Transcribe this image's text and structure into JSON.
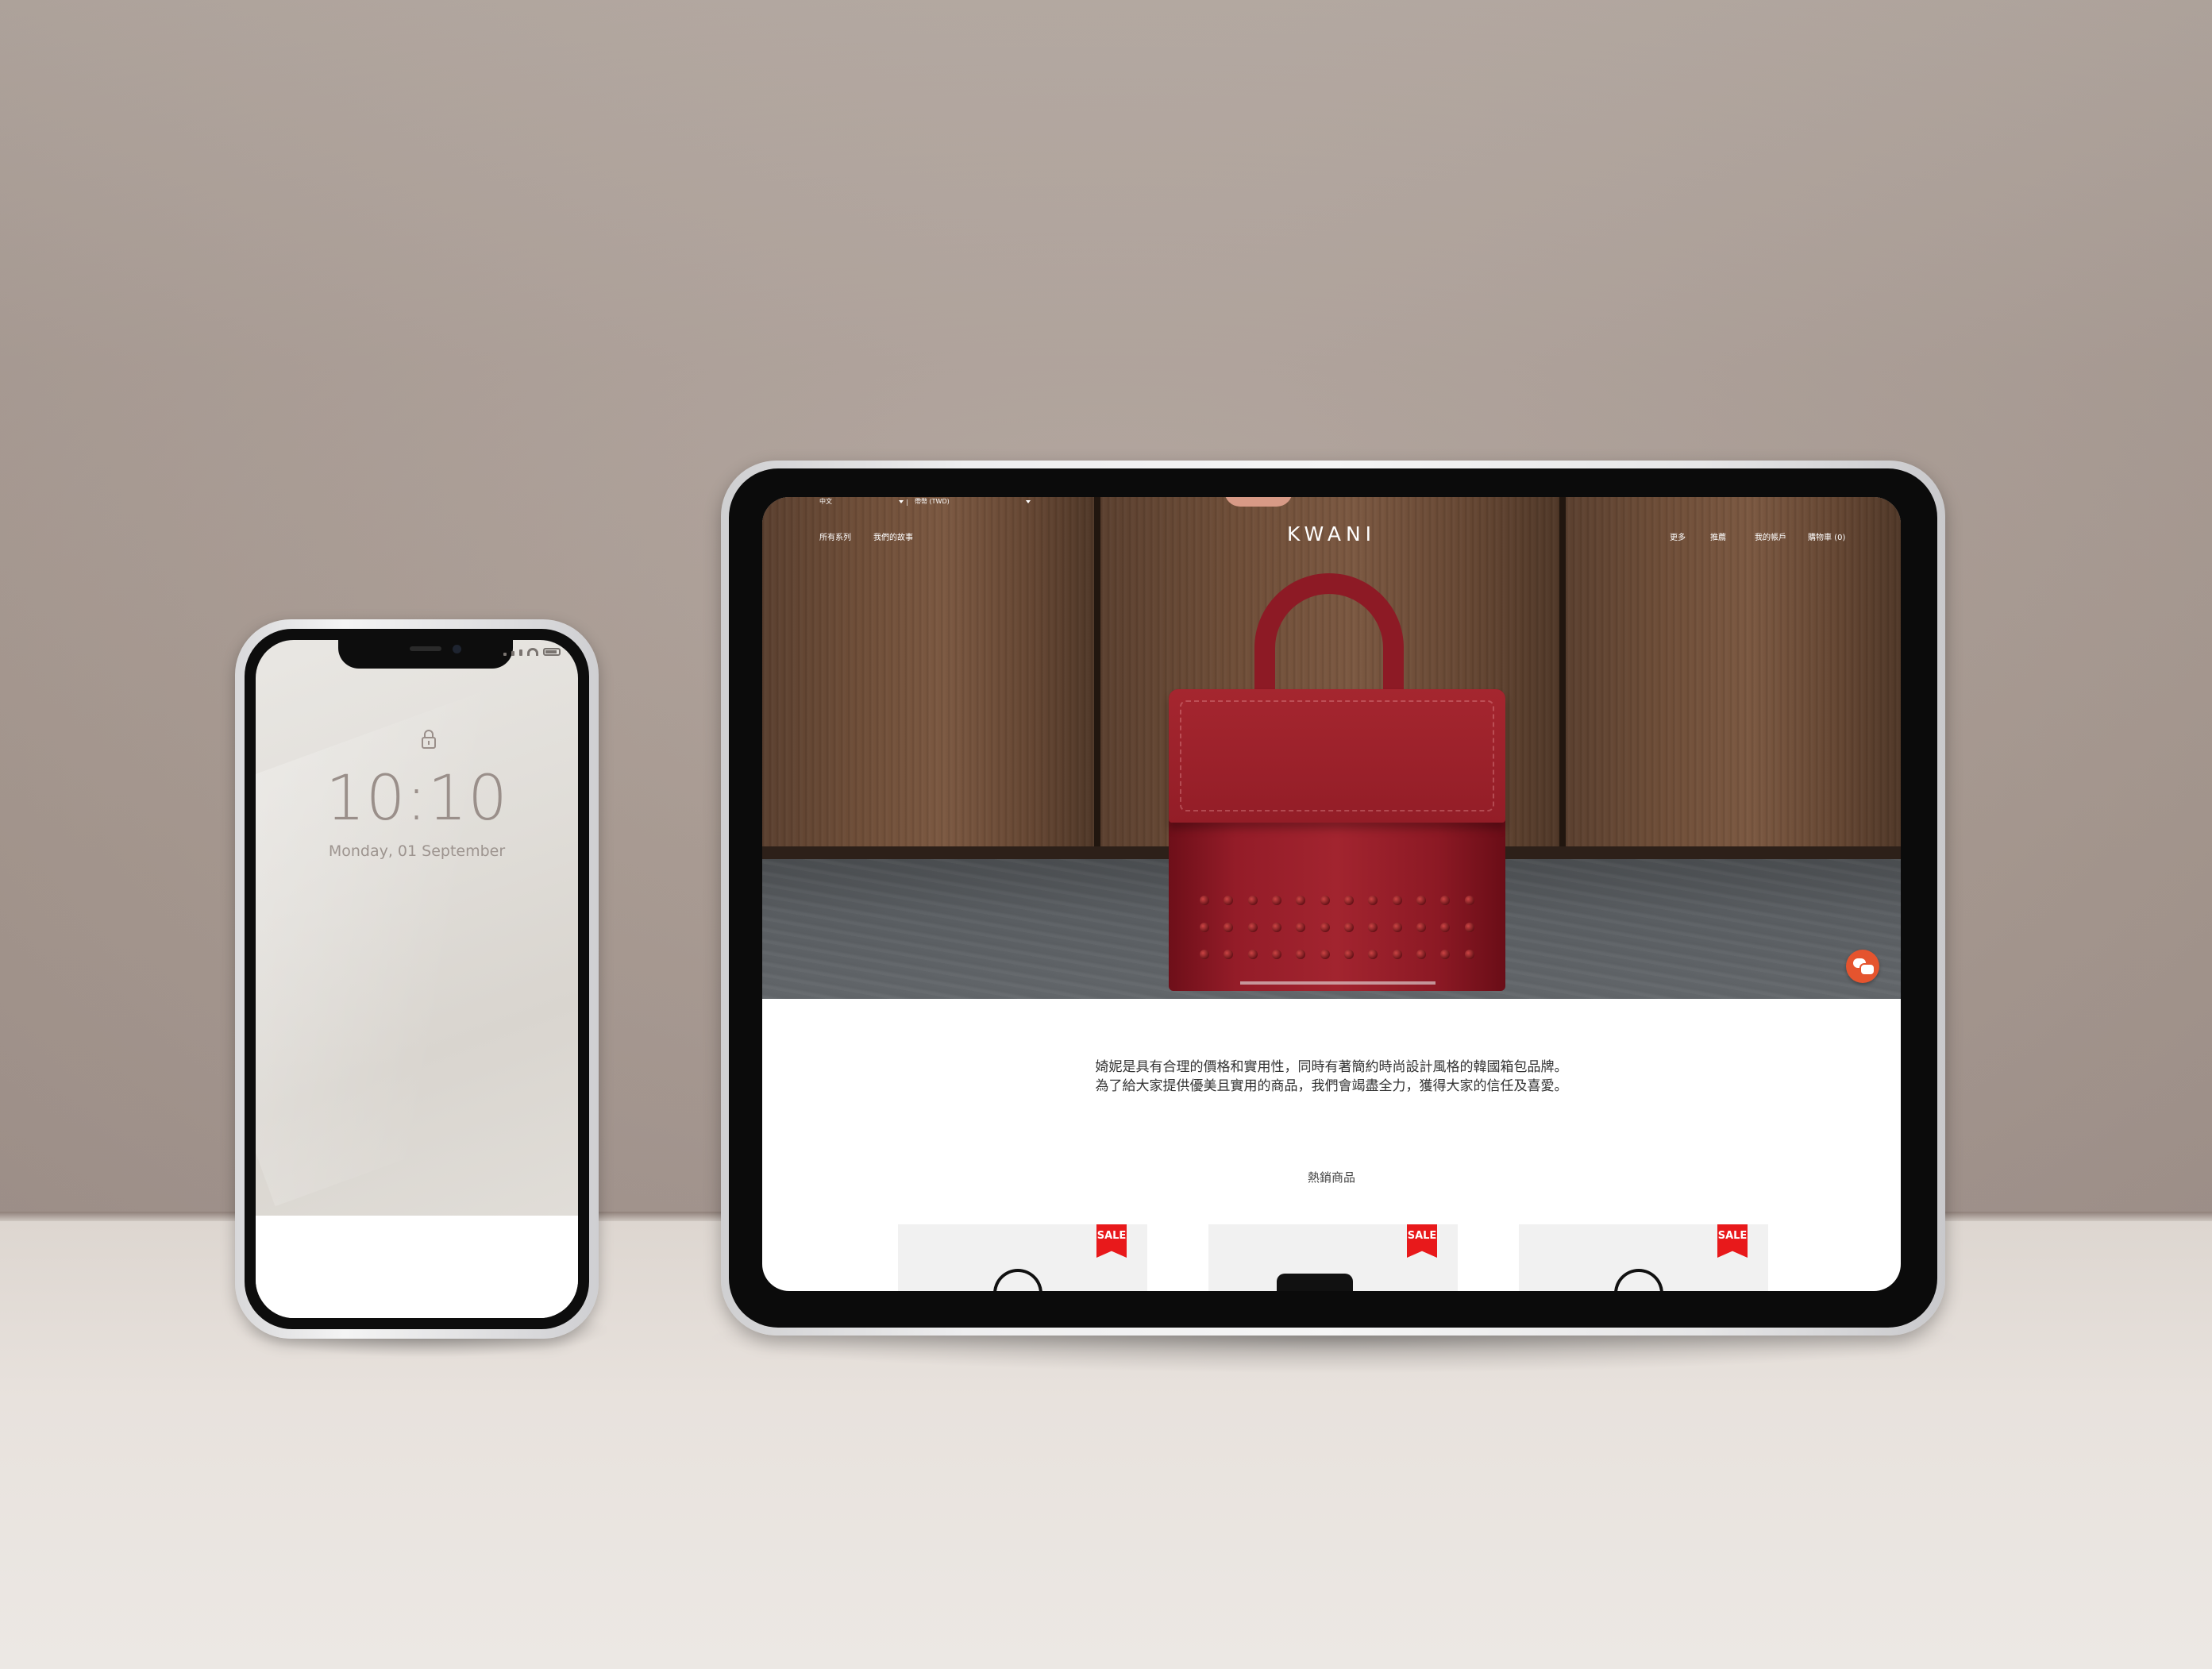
{
  "phone": {
    "lock_time": "10:10",
    "lock_date": "Monday, 01 September"
  },
  "site": {
    "logo": "KWANI",
    "topbar": {
      "language": "中文",
      "currency": "帶幣 (TWD)"
    },
    "nav_left": [
      "所有系列",
      "我們的故事"
    ],
    "nav_right": [
      "更多",
      "推薦",
      "我的帳戶",
      "購物車 (0)"
    ],
    "intro_lines": [
      "婍妮是具有合理的價格和實用性，同時有著簡約時尚設計風格的韓國箱包品牌。",
      "為了給大家提供優美且實用的商品，我們會竭盡全力，獲得大家的信任及喜愛。"
    ],
    "section_title": "熱銷商品",
    "products": [
      {
        "badge": "SALE"
      },
      {
        "badge": "SALE"
      },
      {
        "badge": "SALE"
      }
    ],
    "colors": {
      "sale_red": "#e8191b",
      "chat_orange": "#e5542e",
      "bag_red": "#941c28"
    },
    "icons": [
      "chat-icon",
      "caret-down-icon",
      "lock-icon"
    ]
  }
}
